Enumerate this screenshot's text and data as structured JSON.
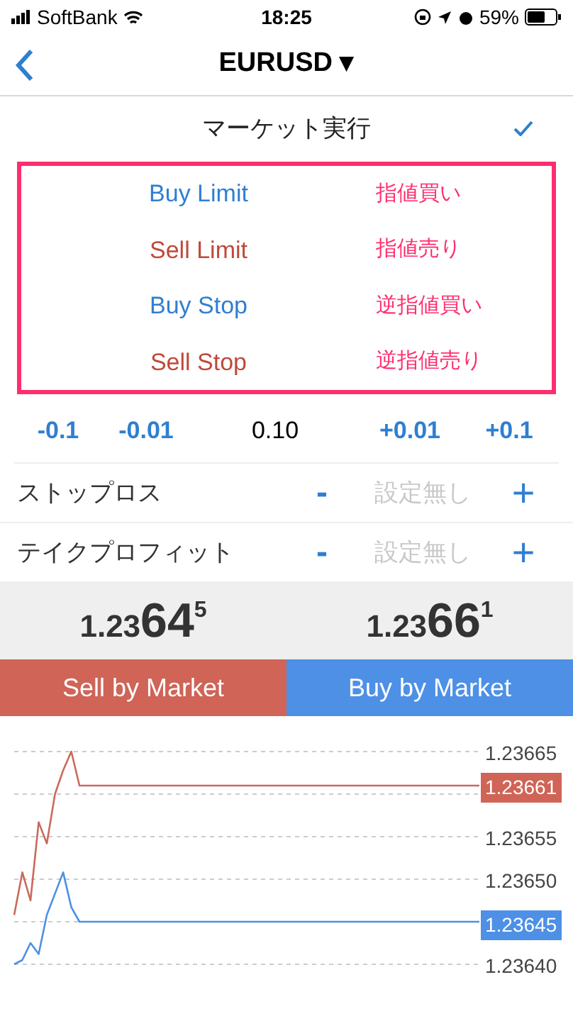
{
  "status_bar": {
    "carrier": "SoftBank",
    "time": "18:25",
    "battery": "59%"
  },
  "nav": {
    "title": "EURUSD ▾"
  },
  "execution": {
    "label": "マーケット実行",
    "checked": true
  },
  "order_types": [
    {
      "label": "Buy Limit",
      "kind": "buy",
      "note": "指値買い"
    },
    {
      "label": "Sell Limit",
      "kind": "sell",
      "note": "指値売り"
    },
    {
      "label": "Buy Stop",
      "kind": "buy",
      "note": "逆指値買い"
    },
    {
      "label": "Sell Stop",
      "kind": "sell",
      "note": "逆指値売り"
    }
  ],
  "volume": {
    "steps_down": [
      "-0.1",
      "-0.01"
    ],
    "value": "0.10",
    "steps_up": [
      "+0.01",
      "+0.1"
    ]
  },
  "levels": [
    {
      "label": "ストップロス",
      "minus": "-",
      "placeholder": "設定無し",
      "plus": "+"
    },
    {
      "label": "テイクプロフィット",
      "minus": "-",
      "placeholder": "設定無し",
      "plus": "+"
    }
  ],
  "prices": [
    {
      "prefix": "1.23",
      "big": "64",
      "sup": "5"
    },
    {
      "prefix": "1.23",
      "big": "66",
      "sup": "1"
    }
  ],
  "buttons": [
    {
      "label": "Sell by Market",
      "kind": "sell"
    },
    {
      "label": "Buy by Market",
      "kind": "buy"
    }
  ],
  "chart": {
    "ask_tag": "1.23661",
    "bid_tag": "1.23645",
    "chart_data": {
      "type": "line",
      "grid": true,
      "ylim": [
        1.2364,
        1.23665
      ],
      "categories": [
        null,
        null,
        null,
        null,
        null,
        null,
        null,
        null,
        null,
        null,
        null,
        null,
        null,
        null,
        null,
        null,
        null,
        null,
        null,
        null,
        null,
        null,
        null,
        null,
        null,
        null,
        null,
        null,
        null,
        null,
        null,
        null,
        null,
        null,
        null,
        null,
        null,
        null,
        null,
        null,
        null,
        null,
        null,
        null,
        null,
        null,
        null,
        null,
        null,
        null,
        null,
        null,
        null,
        null,
        null,
        null,
        null,
        null
      ],
      "yticks": [
        {
          "value": 1.23665,
          "label": "1.23665"
        },
        {
          "value": 1.23655,
          "label": "1.23655"
        },
        {
          "value": 1.2365,
          "label": "1.23650"
        },
        {
          "value": 1.2364,
          "label": "1.23640"
        }
      ],
      "series": [
        {
          "color": "#c96a5c",
          "values": [
            1.236458,
            1.236508,
            1.236475,
            1.236567,
            1.236542,
            1.2366,
            1.236628,
            1.23665,
            1.23661,
            1.23661,
            1.23661,
            1.23661,
            1.23661,
            1.23661,
            1.23661,
            1.23661,
            1.23661,
            1.23661,
            1.23661,
            1.23661,
            1.23661,
            1.23661,
            1.23661,
            1.23661,
            1.23661,
            1.23661,
            1.23661,
            1.23661,
            1.23661,
            1.23661,
            1.23661,
            1.23661,
            1.23661,
            1.23661,
            1.23661,
            1.23661,
            1.23661,
            1.23661,
            1.23661,
            1.23661,
            1.23661,
            1.23661,
            1.23661,
            1.23661,
            1.23661,
            1.23661,
            1.23661,
            1.23661,
            1.23661,
            1.23661,
            1.23661,
            1.23661,
            1.23661,
            1.23661,
            1.23661,
            1.23661,
            1.23661,
            1.23661
          ]
        },
        {
          "color": "#4d90e6",
          "values": [
            1.2364,
            1.236405,
            1.236425,
            1.236412,
            1.236458,
            1.236483,
            1.236508,
            1.236467,
            1.23645,
            1.23645,
            1.23645,
            1.23645,
            1.23645,
            1.23645,
            1.23645,
            1.23645,
            1.23645,
            1.23645,
            1.23645,
            1.23645,
            1.23645,
            1.23645,
            1.23645,
            1.23645,
            1.23645,
            1.23645,
            1.23645,
            1.23645,
            1.23645,
            1.23645,
            1.23645,
            1.23645,
            1.23645,
            1.23645,
            1.23645,
            1.23645,
            1.23645,
            1.23645,
            1.23645,
            1.23645,
            1.23645,
            1.23645,
            1.23645,
            1.23645,
            1.23645,
            1.23645,
            1.23645,
            1.23645,
            1.23645,
            1.23645,
            1.23645,
            1.23645,
            1.23645,
            1.23645,
            1.23645,
            1.23645,
            1.23645,
            1.23645
          ]
        }
      ]
    }
  }
}
